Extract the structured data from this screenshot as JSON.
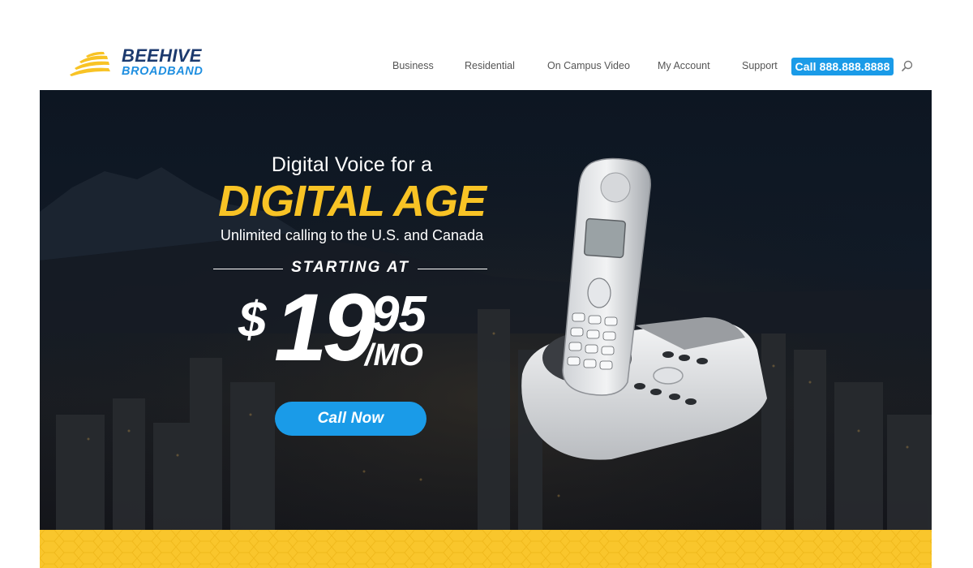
{
  "brand": {
    "name_top": "BEEHIVE",
    "name_bottom": "BROADBAND",
    "colors": {
      "navy": "#1c3a6e",
      "blue": "#1f8fe0",
      "yellow": "#f8c325"
    }
  },
  "nav": {
    "items": [
      {
        "label": "Business"
      },
      {
        "label": "Residential"
      },
      {
        "label": "On Campus Video"
      },
      {
        "label": "My Account"
      },
      {
        "label": "Support"
      }
    ],
    "call_label": "Call 888.888.8888",
    "search_icon": "search-icon"
  },
  "hero": {
    "heading_line1": "Digital Voice for a",
    "heading_line2": "DIGITAL AGE",
    "subheading": "Unlimited calling to the U.S. and Canada",
    "starting_label": "STARTING AT",
    "price": {
      "currency": "$",
      "dollars": "19",
      "cents": "95",
      "per": "/MO"
    },
    "cta_label": "Call Now",
    "image": "cordless-phone-icon"
  },
  "colors": {
    "accent_blue": "#1a9be8",
    "band_yellow": "#f9c62c",
    "hero_dark": "#111a26"
  }
}
